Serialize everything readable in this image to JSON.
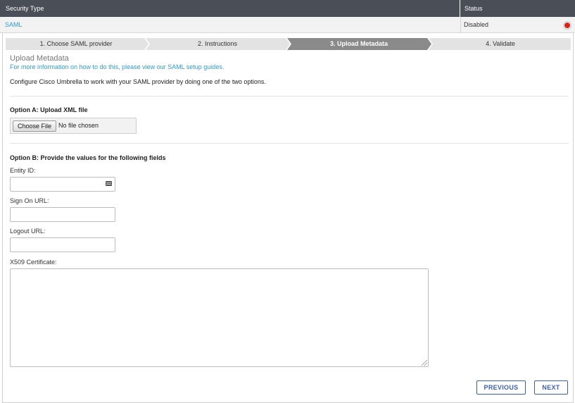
{
  "table": {
    "header": {
      "security_type": "Security Type",
      "status": "Status"
    },
    "row": {
      "type": "SAML",
      "status": "Disabled",
      "status_color": "#e02016"
    }
  },
  "steps": [
    {
      "label": "1. Choose SAML provider",
      "active": false
    },
    {
      "label": "2. Instructions",
      "active": false
    },
    {
      "label": "3. Upload Metadata",
      "active": true
    },
    {
      "label": "4. Validate",
      "active": false
    }
  ],
  "section": {
    "title": "Upload Metadata",
    "help_link": "For more information on how to do this, please view our SAML setup guides.",
    "intro": "Configure Cisco Umbrella to work with your SAML provider by doing one of the two options."
  },
  "option_a": {
    "title": "Option A: Upload XML file",
    "choose_button": "Choose File",
    "file_status": "No file chosen"
  },
  "option_b": {
    "title": "Option B: Provide the values for the following fields",
    "entity_id_label": "Entity ID:",
    "entity_id_value": "",
    "sign_on_label": "Sign On URL:",
    "sign_on_value": "",
    "logout_label": "Logout URL:",
    "logout_value": "",
    "cert_label": "X509 Certificate:",
    "cert_value": ""
  },
  "buttons": {
    "previous": "PREVIOUS",
    "next": "NEXT"
  },
  "colors": {
    "header_bg": "#4a4e57",
    "link": "#2f9bd0",
    "active_step": "#8a8a8a",
    "inactive_step": "#e3e3e3",
    "button": "#3a5fb0"
  },
  "icons": {
    "entity_field_icon": "keyboard-icon",
    "status_icon": "status-dot-icon",
    "resize_icon": "resize-grip-icon"
  }
}
